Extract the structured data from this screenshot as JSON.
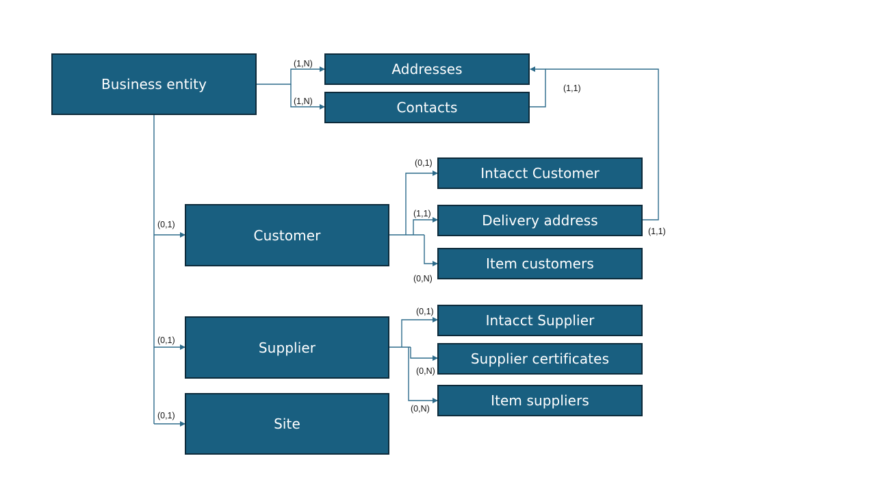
{
  "diagram": {
    "entities": {
      "business_entity": "Business entity",
      "addresses": "Addresses",
      "contacts": "Contacts",
      "customer": "Customer",
      "intacct_customer": "Intacct Customer",
      "delivery_address": "Delivery address",
      "item_customers": "Item customers",
      "supplier": "Supplier",
      "intacct_supplier": "Intacct Supplier",
      "supplier_certificates": "Supplier certificates",
      "item_suppliers": "Item suppliers",
      "site": "Site"
    },
    "cardinalities": {
      "be_addresses": "(1,N)",
      "be_contacts": "(1,N)",
      "contacts_addresses": "(1,1)",
      "be_customer": "(0,1)",
      "be_supplier": "(0,1)",
      "be_site": "(0,1)",
      "customer_intacct": "(0,1)",
      "customer_delivery": "(1,1)",
      "customer_items": "(0,N)",
      "delivery_addresses": "(1,1)",
      "supplier_intacct": "(0,1)",
      "supplier_certificates": "(0,N)",
      "supplier_items": "(0,N)"
    },
    "colors": {
      "box_fill": "#195f80",
      "box_border": "#0c2a3a",
      "connector": "#2b6a8a"
    }
  }
}
